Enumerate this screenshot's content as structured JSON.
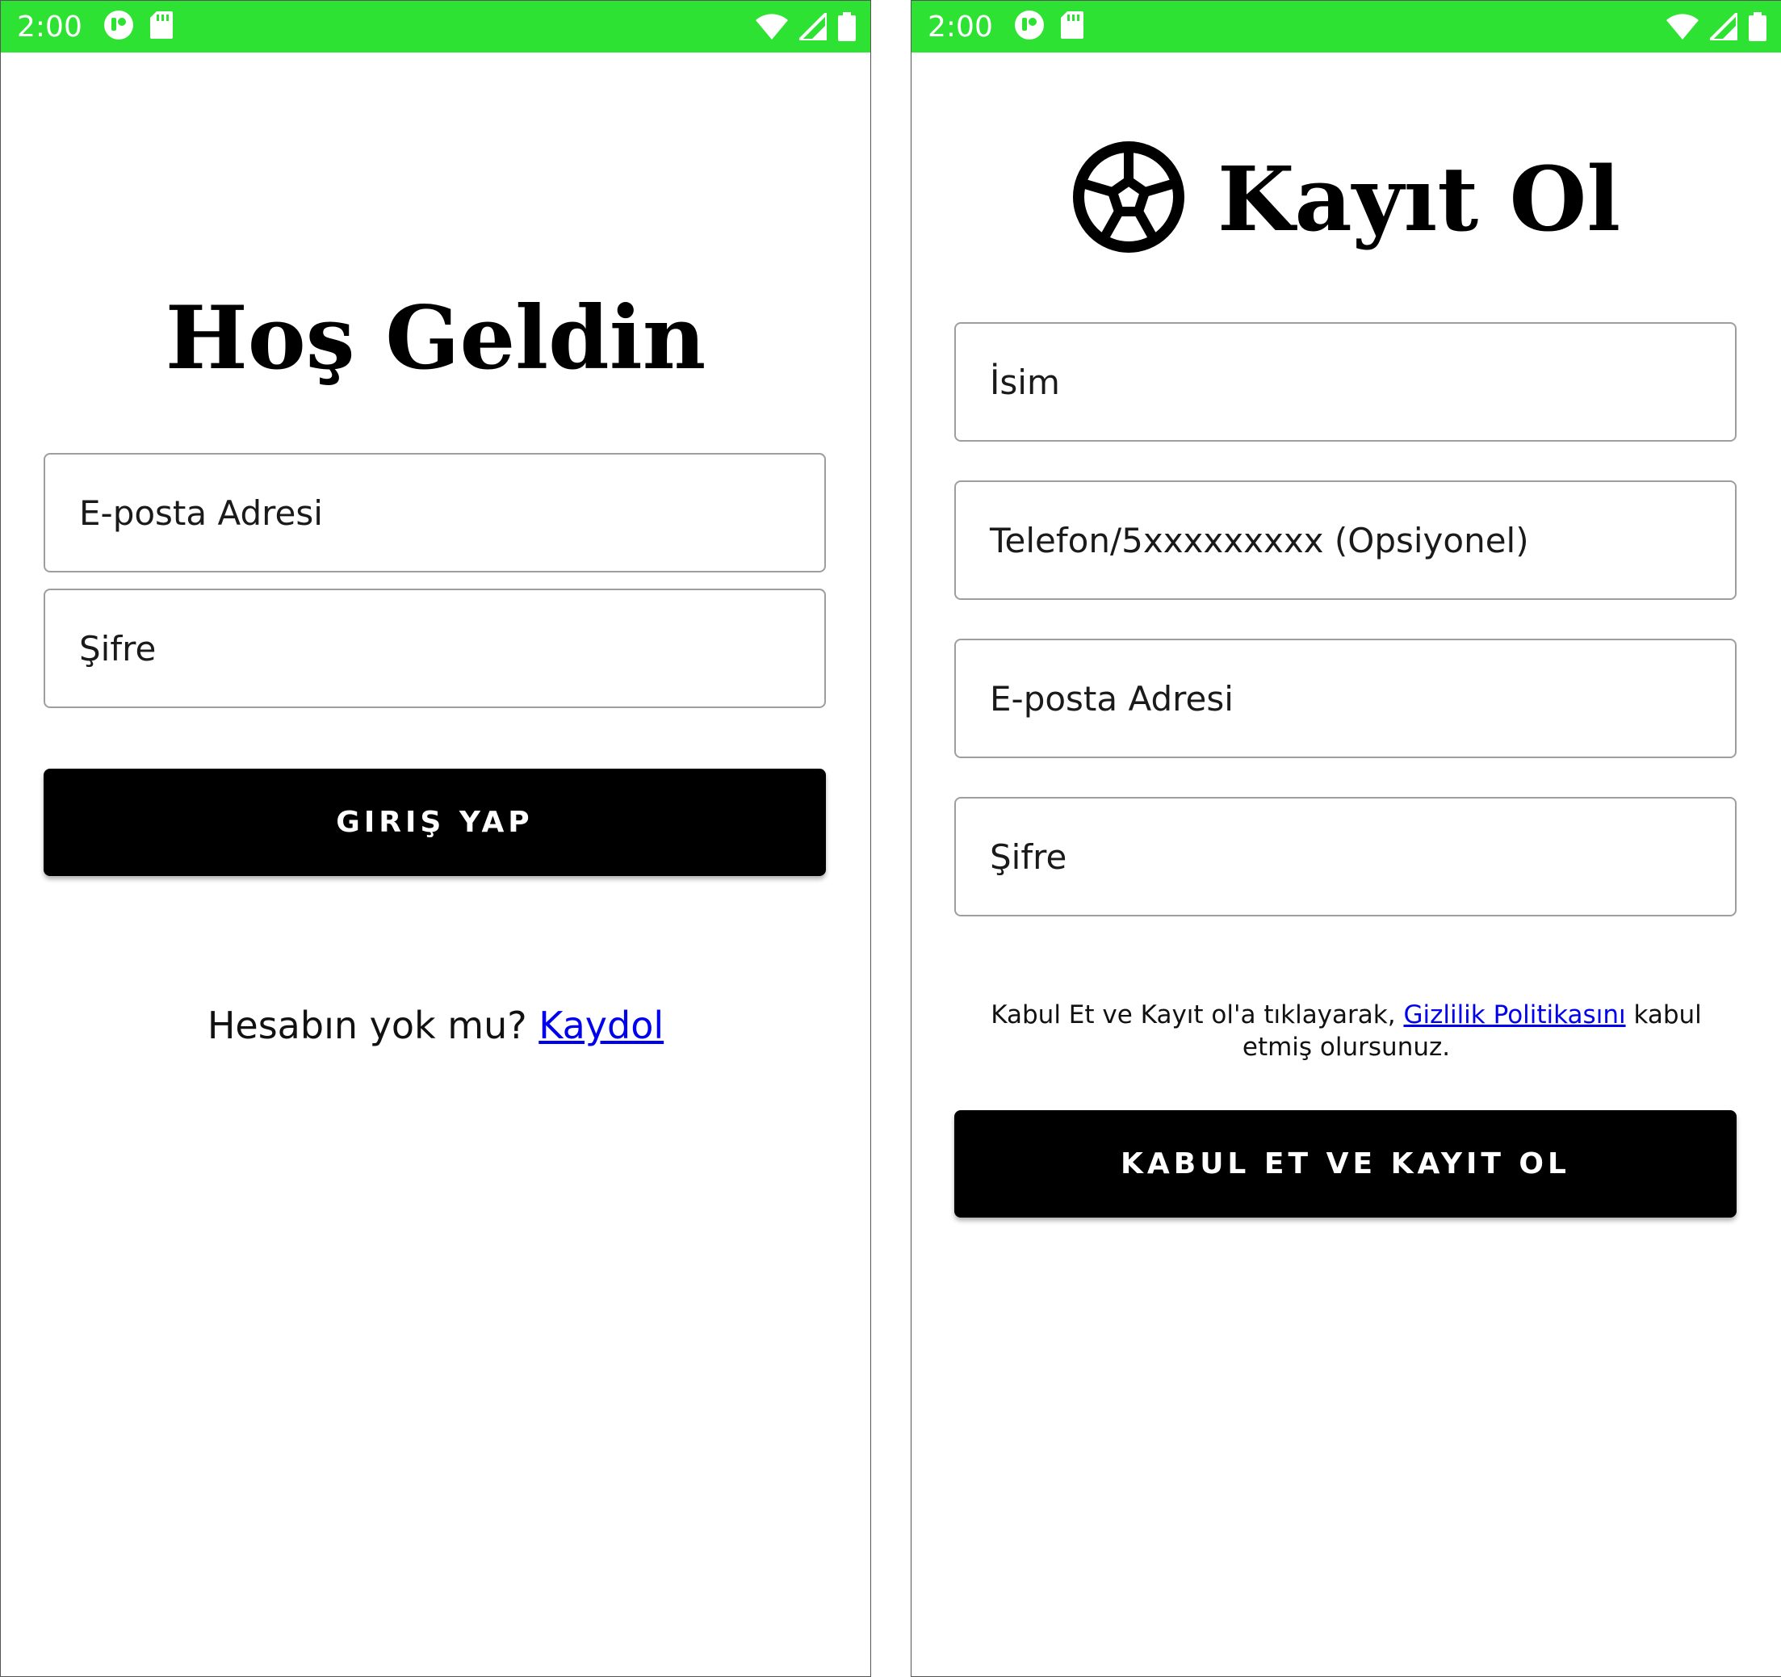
{
  "colors": {
    "status_bar": "#2de232",
    "button_bg": "#000000",
    "link": "#0000ee",
    "field_border": "#9e9e9e"
  },
  "login": {
    "status_bar": {
      "time": "2:00",
      "icons": [
        "record-icon",
        "sd-card-icon",
        "wifi-icon",
        "signal-icon",
        "battery-icon"
      ]
    },
    "title": "Hoş Geldin",
    "email_placeholder": "E-posta Adresi",
    "password_placeholder": "Şifre",
    "submit_label": "GIRIŞ YAP",
    "signup_prompt": "Hesabın yok mu?",
    "signup_link": "Kaydol"
  },
  "register": {
    "status_bar": {
      "time": "2:00",
      "icons": [
        "record-icon",
        "sd-card-icon",
        "wifi-icon",
        "signal-icon",
        "battery-icon"
      ]
    },
    "logo_icon": "soccer-ball-icon",
    "title": "Kayıt Ol",
    "name_placeholder": "İsim",
    "phone_placeholder": "Telefon/5xxxxxxxxx (Opsiyonel)",
    "email_placeholder": "E-posta Adresi",
    "password_placeholder": "Şifre",
    "terms_prefix": "Kabul Et ve Kayıt ol'a tıklayarak,",
    "terms_link": "Gizlilik Politikasını",
    "terms_suffix": "kabul etmiş olursunuz.",
    "submit_label": "KABUL ET VE KAYIT OL"
  }
}
